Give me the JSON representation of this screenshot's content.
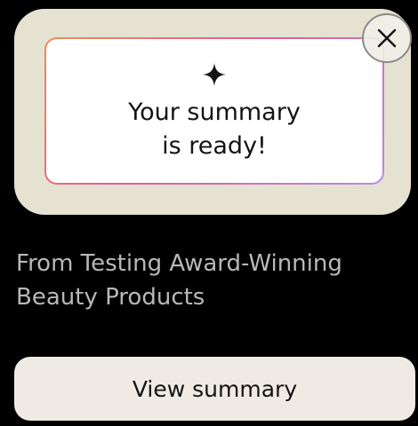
{
  "preview": {
    "icon": "sparkle-icon",
    "line1": "Your summary",
    "line2": "is ready!",
    "close_icon": "close-icon"
  },
  "source": {
    "title_line1": "From Testing Award-Winning",
    "title_line2": "Beauty Products"
  },
  "actions": {
    "view_label": "View summary"
  },
  "colors": {
    "background": "#000000",
    "card": "#e6e2d2",
    "panel": "#ffffff",
    "button": "#efeae4",
    "source_text": "#b8b8b8"
  }
}
